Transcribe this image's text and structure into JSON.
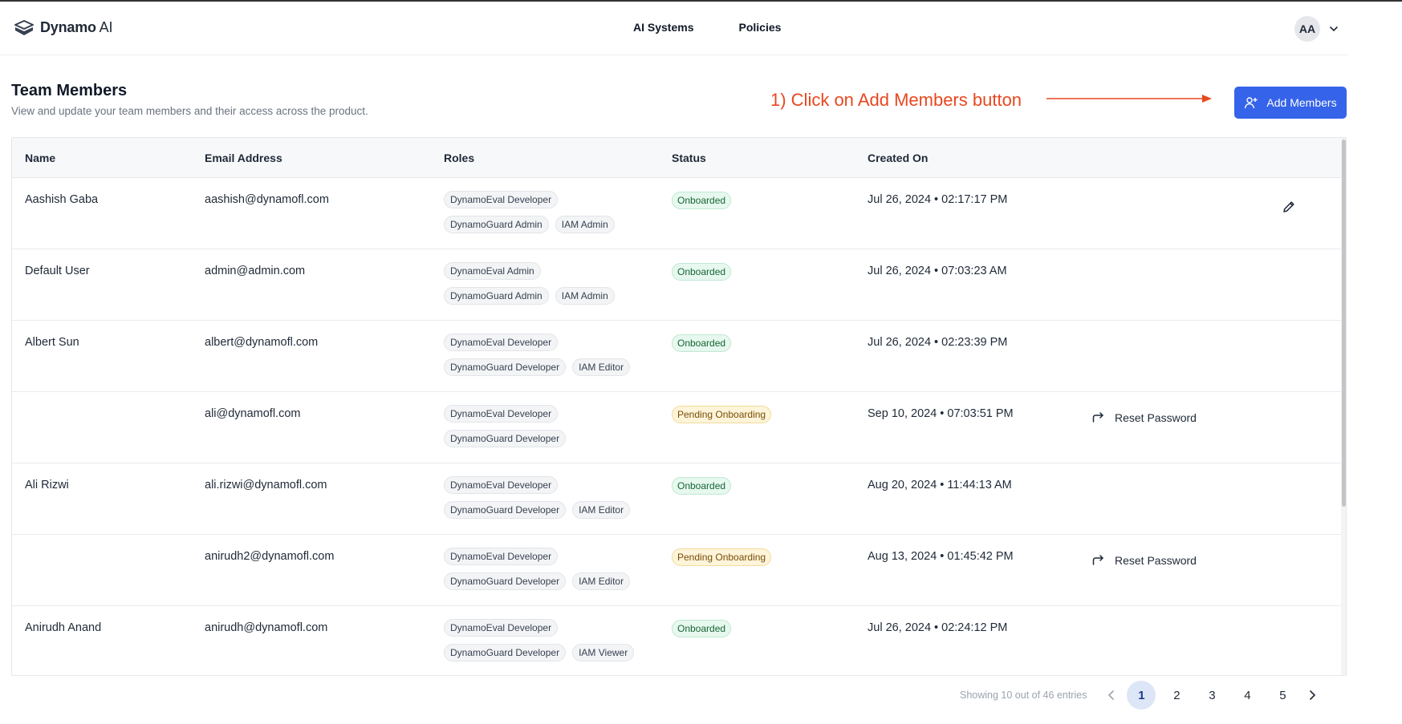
{
  "header": {
    "brand_main": "Dynamo",
    "brand_suffix": " AI",
    "nav": [
      "AI Systems",
      "Policies"
    ],
    "avatar": "AA"
  },
  "page": {
    "title": "Team Members",
    "subtitle": "View and update your team members and their access across the product.",
    "annotation": "1) Click on Add Members button",
    "add_button": "Add Members",
    "accent_color": "#3563e9",
    "annotation_color": "#e8481f"
  },
  "table": {
    "columns": [
      "Name",
      "Email Address",
      "Roles",
      "Status",
      "Created On"
    ],
    "reset_label": "Reset Password",
    "rows": [
      {
        "name": "Aashish Gaba",
        "email": "aashish@dynamofl.com",
        "roles": [
          "DynamoEval Developer",
          "DynamoGuard Admin",
          "IAM Admin"
        ],
        "status": "Onboarded",
        "created": "Jul 26, 2024 • 02:17:17 PM",
        "action": "edit"
      },
      {
        "name": "Default User",
        "email": "admin@admin.com",
        "roles": [
          "DynamoEval Admin",
          "DynamoGuard Admin",
          "IAM Admin"
        ],
        "status": "Onboarded",
        "created": "Jul 26, 2024 • 07:03:23 AM",
        "action": ""
      },
      {
        "name": "Albert Sun",
        "email": "albert@dynamofl.com",
        "roles": [
          "DynamoEval Developer",
          "DynamoGuard Developer",
          "IAM Editor"
        ],
        "status": "Onboarded",
        "created": "Jul 26, 2024 • 02:23:39 PM",
        "action": ""
      },
      {
        "name": "",
        "email": "ali@dynamofl.com",
        "roles": [
          "DynamoEval Developer",
          "DynamoGuard Developer"
        ],
        "status": "Pending Onboarding",
        "created": "Sep 10, 2024 • 07:03:51 PM",
        "action": "reset"
      },
      {
        "name": "Ali Rizwi",
        "email": "ali.rizwi@dynamofl.com",
        "roles": [
          "DynamoEval Developer",
          "DynamoGuard Developer",
          "IAM Editor"
        ],
        "status": "Onboarded",
        "created": "Aug 20, 2024 • 11:44:13 AM",
        "action": ""
      },
      {
        "name": "",
        "email": "anirudh2@dynamofl.com",
        "roles": [
          "DynamoEval Developer",
          "DynamoGuard Developer",
          "IAM Editor"
        ],
        "status": "Pending Onboarding",
        "created": "Aug 13, 2024 • 01:45:42 PM",
        "action": "reset"
      },
      {
        "name": "Anirudh Anand",
        "email": "anirudh@dynamofl.com",
        "roles": [
          "DynamoEval Developer",
          "DynamoGuard Developer",
          "IAM Viewer"
        ],
        "status": "Onboarded",
        "created": "Jul 26, 2024 • 02:24:12 PM",
        "action": ""
      }
    ]
  },
  "pagination": {
    "info": "Showing 10 out of 46 entries",
    "pages": [
      "1",
      "2",
      "3",
      "4",
      "5"
    ],
    "current": "1"
  }
}
